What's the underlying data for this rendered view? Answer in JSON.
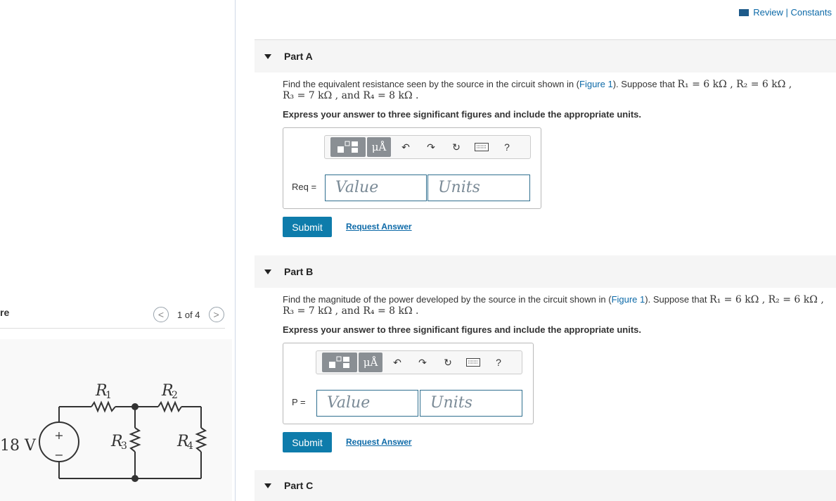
{
  "header": {
    "review_constants": "Review | Constants"
  },
  "figure_panel": {
    "title": "re",
    "counter": "1 of 4",
    "prev_glyph": "<",
    "next_glyph": ">",
    "circuit": {
      "source_label": "18 V",
      "r1": "R",
      "r1_sub": "1",
      "r2": "R",
      "r2_sub": "2",
      "r3": "R",
      "r3_sub": "3",
      "r4": "R",
      "r4_sub": "4",
      "plus": "+",
      "minus": "−"
    }
  },
  "parts": [
    {
      "title": "Part A",
      "question_prefix": "Find the equivalent resistance seen by the source in the circuit shown in (",
      "figure_link": "Figure 1",
      "question_suffix": "). Suppose that",
      "given_line1": "R₁ = 6  kΩ , R₂ = 6  kΩ ,",
      "given_line2": "R₃ = 7  kΩ , and R₄ = 8  kΩ .",
      "instruction": "Express your answer to three significant figures and include the appropriate units.",
      "var_label": "Req =",
      "value_placeholder": "Value",
      "units_placeholder": "Units",
      "submit": "Submit",
      "request": "Request Answer"
    },
    {
      "title": "Part B",
      "question_prefix": "Find the magnitude of the power developed by the source in the circuit shown in (",
      "figure_link": "Figure 1",
      "question_suffix": "). Suppose that",
      "given_line1": "R₁ = 6  kΩ , R₂ = 6  kΩ ,",
      "given_line2": "R₃ = 7  kΩ , and R₄ = 8  kΩ .",
      "instruction": "Express your answer to three significant figures and include the appropriate units.",
      "var_label": "P =",
      "value_placeholder": "Value",
      "units_placeholder": "Units",
      "submit": "Submit",
      "request": "Request Answer"
    },
    {
      "title": "Part C"
    }
  ],
  "toolbar": {
    "units_symbol": "μÅ",
    "help": "?"
  }
}
